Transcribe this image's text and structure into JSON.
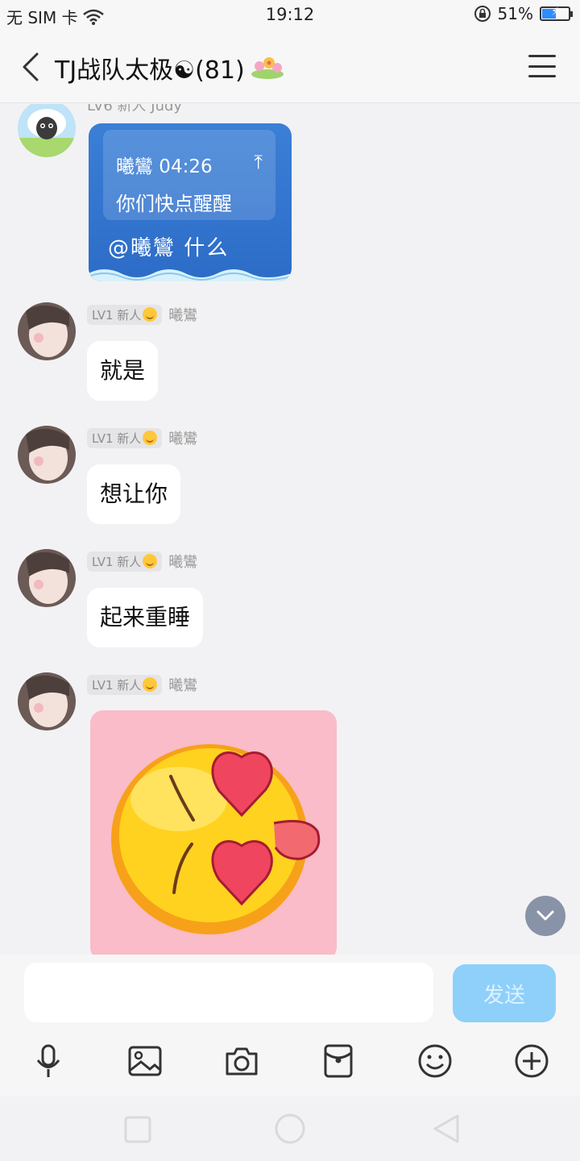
{
  "status_bar": {
    "carrier": "无 SIM 卡",
    "time": "19:12",
    "battery_percent": "51%",
    "battery_level": 0.51
  },
  "header": {
    "title": "TJ战队太极☯(81)"
  },
  "messages": [
    {
      "sender_partial": "LV6 新人 Judy",
      "quoted_time": "曦鸞 04:26",
      "quoted_text": "你们快点醒醒",
      "text": "@曦鸞 什么"
    },
    {
      "level": "LV1 新人",
      "sender": "曦鸞",
      "text": "就是"
    },
    {
      "level": "LV1 新人",
      "sender": "曦鸞",
      "text": "想让你"
    },
    {
      "level": "LV1 新人",
      "sender": "曦鸞",
      "text": "起来重睡"
    },
    {
      "level": "LV1 新人",
      "sender": "曦鸞",
      "sticker": "love-eyes-emoji"
    }
  ],
  "input": {
    "placeholder": "",
    "send_label": "发送"
  },
  "toolbar": {
    "icons": [
      "microphone-icon",
      "image-icon",
      "camera-icon",
      "red-packet-icon",
      "emoji-icon",
      "plus-icon"
    ]
  },
  "colors": {
    "accent": "#8ed0fa",
    "bubble_special": "#3b7fd6",
    "sticker_bg": "#f9bcc8"
  }
}
